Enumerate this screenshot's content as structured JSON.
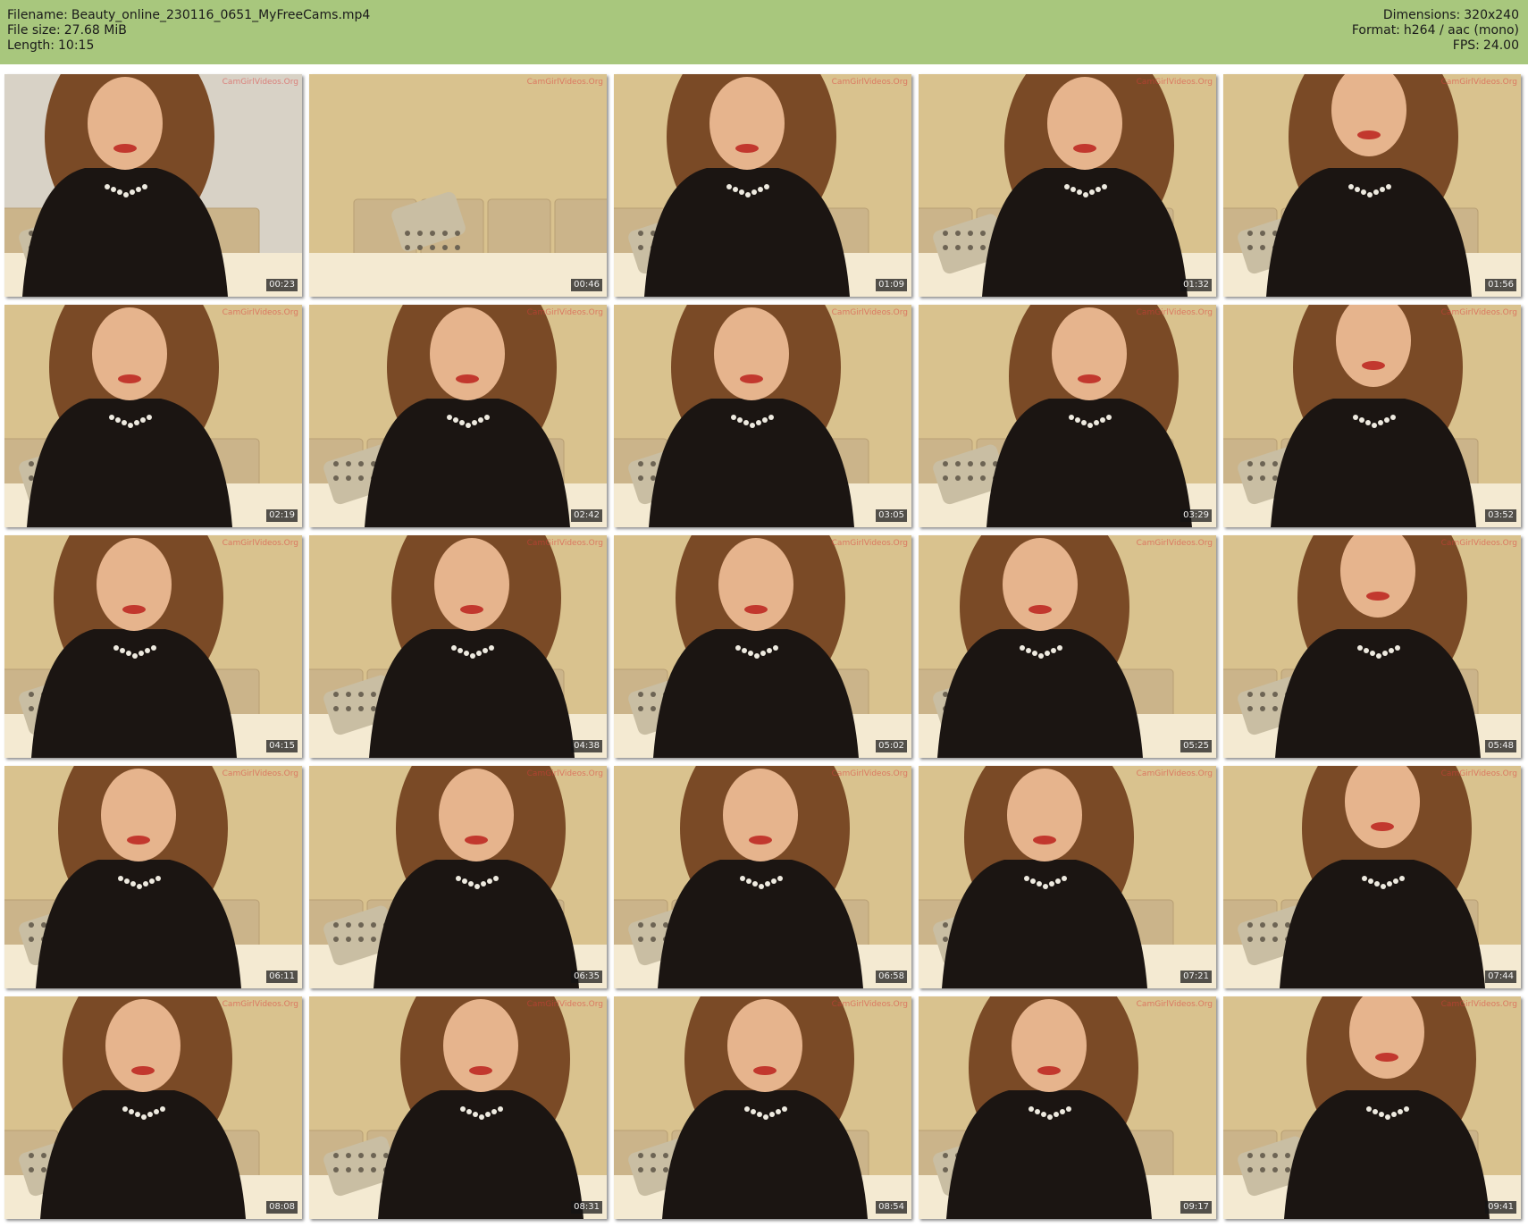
{
  "header": {
    "filename_label": "Filename:",
    "filename": "Beauty_online_230116_0651_MyFreeCams.mp4",
    "filesize_label": "File size:",
    "filesize": "27.68 MiB",
    "length_label": "Length:",
    "length": "10:15",
    "dimensions_label": "Dimensions:",
    "dimensions": "320x240",
    "format_label": "Format:",
    "format": "h264 / aac (mono)",
    "fps_label": "FPS:",
    "fps": "24.00"
  },
  "colors": {
    "header_bg": "#a8c77d",
    "page_bg": "#ffffff"
  },
  "watermark": "CamGirlVideos.Org",
  "thumbnails": [
    {
      "timestamp": "00:23"
    },
    {
      "timestamp": "00:46"
    },
    {
      "timestamp": "01:09"
    },
    {
      "timestamp": "01:32"
    },
    {
      "timestamp": "01:56"
    },
    {
      "timestamp": "02:19"
    },
    {
      "timestamp": "02:42"
    },
    {
      "timestamp": "03:05"
    },
    {
      "timestamp": "03:29"
    },
    {
      "timestamp": "03:52"
    },
    {
      "timestamp": "04:15"
    },
    {
      "timestamp": "04:38"
    },
    {
      "timestamp": "05:02"
    },
    {
      "timestamp": "05:25"
    },
    {
      "timestamp": "05:48"
    },
    {
      "timestamp": "06:11"
    },
    {
      "timestamp": "06:35"
    },
    {
      "timestamp": "06:58"
    },
    {
      "timestamp": "07:21"
    },
    {
      "timestamp": "07:44"
    },
    {
      "timestamp": "08:08"
    },
    {
      "timestamp": "08:31"
    },
    {
      "timestamp": "08:54"
    },
    {
      "timestamp": "09:17"
    },
    {
      "timestamp": "09:41"
    }
  ]
}
